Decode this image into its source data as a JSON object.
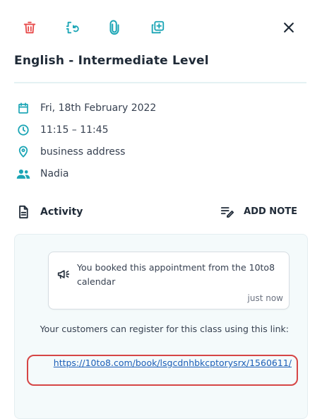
{
  "toolbar": {
    "icons": [
      "trash-icon",
      "reschedule-icon",
      "attachment-icon",
      "duplicate-icon",
      "close-icon"
    ],
    "colors": {
      "delete": "#e84a4a",
      "action": "#1aa5b5",
      "close": "#1f2a37"
    }
  },
  "appointment": {
    "title": "English - Intermediate Level",
    "date": "Fri, 18th February 2022",
    "time": "11:15 – 11:45",
    "location": "business address",
    "staff": "Nadia"
  },
  "activity": {
    "label": "Activity",
    "add_note_label": "ADD NOTE"
  },
  "feed": {
    "message": "You booked this appointment from the 10to8 calendar",
    "message_time": "just now",
    "register_note": "Your customers can register for this class using this link:",
    "register_link": "https://10to8.com/book/lsgcdnhbkcptorysrx/1560611/"
  },
  "accent_colors": {
    "teal": "#1aa5b5",
    "highlight": "#d64545",
    "link": "#1d5fb8"
  }
}
